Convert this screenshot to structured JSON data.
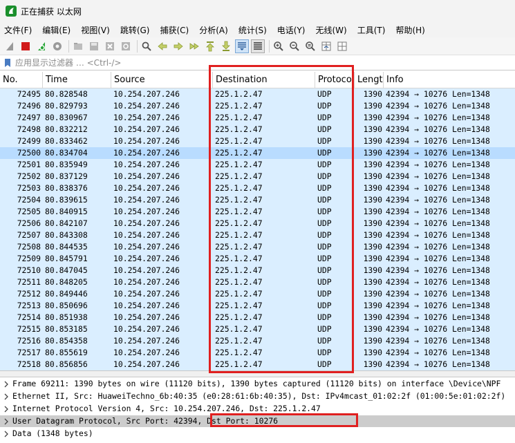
{
  "window": {
    "title": "正在捕获 以太网"
  },
  "menu": [
    "文件(F)",
    "编辑(E)",
    "视图(V)",
    "跳转(G)",
    "捕获(C)",
    "分析(A)",
    "统计(S)",
    "电话(Y)",
    "无线(W)",
    "工具(T)",
    "帮助(H)"
  ],
  "filter": {
    "placeholder": "应用显示过滤器 … <Ctrl-/>"
  },
  "columns": {
    "no": "No.",
    "time": "Time",
    "source": "Source",
    "destination": "Destination",
    "protocol": "Protoco",
    "length": "Lengt",
    "info": "Info"
  },
  "packets": [
    {
      "no": "72495",
      "time": "80.828548",
      "src": "10.254.207.246",
      "dst": "225.1.2.47",
      "proto": "UDP",
      "len": "1390",
      "info": "42394 → 10276 Len=1348"
    },
    {
      "no": "72496",
      "time": "80.829793",
      "src": "10.254.207.246",
      "dst": "225.1.2.47",
      "proto": "UDP",
      "len": "1390",
      "info": "42394 → 10276 Len=1348"
    },
    {
      "no": "72497",
      "time": "80.830967",
      "src": "10.254.207.246",
      "dst": "225.1.2.47",
      "proto": "UDP",
      "len": "1390",
      "info": "42394 → 10276 Len=1348"
    },
    {
      "no": "72498",
      "time": "80.832212",
      "src": "10.254.207.246",
      "dst": "225.1.2.47",
      "proto": "UDP",
      "len": "1390",
      "info": "42394 → 10276 Len=1348"
    },
    {
      "no": "72499",
      "time": "80.833462",
      "src": "10.254.207.246",
      "dst": "225.1.2.47",
      "proto": "UDP",
      "len": "1390",
      "info": "42394 → 10276 Len=1348"
    },
    {
      "no": "72500",
      "time": "80.834704",
      "src": "10.254.207.246",
      "dst": "225.1.2.47",
      "proto": "UDP",
      "len": "1390",
      "info": "42394 → 10276 Len=1348",
      "selected": true
    },
    {
      "no": "72501",
      "time": "80.835949",
      "src": "10.254.207.246",
      "dst": "225.1.2.47",
      "proto": "UDP",
      "len": "1390",
      "info": "42394 → 10276 Len=1348"
    },
    {
      "no": "72502",
      "time": "80.837129",
      "src": "10.254.207.246",
      "dst": "225.1.2.47",
      "proto": "UDP",
      "len": "1390",
      "info": "42394 → 10276 Len=1348"
    },
    {
      "no": "72503",
      "time": "80.838376",
      "src": "10.254.207.246",
      "dst": "225.1.2.47",
      "proto": "UDP",
      "len": "1390",
      "info": "42394 → 10276 Len=1348"
    },
    {
      "no": "72504",
      "time": "80.839615",
      "src": "10.254.207.246",
      "dst": "225.1.2.47",
      "proto": "UDP",
      "len": "1390",
      "info": "42394 → 10276 Len=1348"
    },
    {
      "no": "72505",
      "time": "80.840915",
      "src": "10.254.207.246",
      "dst": "225.1.2.47",
      "proto": "UDP",
      "len": "1390",
      "info": "42394 → 10276 Len=1348"
    },
    {
      "no": "72506",
      "time": "80.842107",
      "src": "10.254.207.246",
      "dst": "225.1.2.47",
      "proto": "UDP",
      "len": "1390",
      "info": "42394 → 10276 Len=1348"
    },
    {
      "no": "72507",
      "time": "80.843308",
      "src": "10.254.207.246",
      "dst": "225.1.2.47",
      "proto": "UDP",
      "len": "1390",
      "info": "42394 → 10276 Len=1348"
    },
    {
      "no": "72508",
      "time": "80.844535",
      "src": "10.254.207.246",
      "dst": "225.1.2.47",
      "proto": "UDP",
      "len": "1390",
      "info": "42394 → 10276 Len=1348"
    },
    {
      "no": "72509",
      "time": "80.845791",
      "src": "10.254.207.246",
      "dst": "225.1.2.47",
      "proto": "UDP",
      "len": "1390",
      "info": "42394 → 10276 Len=1348"
    },
    {
      "no": "72510",
      "time": "80.847045",
      "src": "10.254.207.246",
      "dst": "225.1.2.47",
      "proto": "UDP",
      "len": "1390",
      "info": "42394 → 10276 Len=1348"
    },
    {
      "no": "72511",
      "time": "80.848205",
      "src": "10.254.207.246",
      "dst": "225.1.2.47",
      "proto": "UDP",
      "len": "1390",
      "info": "42394 → 10276 Len=1348"
    },
    {
      "no": "72512",
      "time": "80.849446",
      "src": "10.254.207.246",
      "dst": "225.1.2.47",
      "proto": "UDP",
      "len": "1390",
      "info": "42394 → 10276 Len=1348"
    },
    {
      "no": "72513",
      "time": "80.850696",
      "src": "10.254.207.246",
      "dst": "225.1.2.47",
      "proto": "UDP",
      "len": "1390",
      "info": "42394 → 10276 Len=1348"
    },
    {
      "no": "72514",
      "time": "80.851938",
      "src": "10.254.207.246",
      "dst": "225.1.2.47",
      "proto": "UDP",
      "len": "1390",
      "info": "42394 → 10276 Len=1348"
    },
    {
      "no": "72515",
      "time": "80.853185",
      "src": "10.254.207.246",
      "dst": "225.1.2.47",
      "proto": "UDP",
      "len": "1390",
      "info": "42394 → 10276 Len=1348"
    },
    {
      "no": "72516",
      "time": "80.854358",
      "src": "10.254.207.246",
      "dst": "225.1.2.47",
      "proto": "UDP",
      "len": "1390",
      "info": "42394 → 10276 Len=1348"
    },
    {
      "no": "72517",
      "time": "80.855619",
      "src": "10.254.207.246",
      "dst": "225.1.2.47",
      "proto": "UDP",
      "len": "1390",
      "info": "42394 → 10276 Len=1348"
    },
    {
      "no": "72518",
      "time": "80.856856",
      "src": "10.254.207.246",
      "dst": "225.1.2.47",
      "proto": "UDP",
      "len": "1390",
      "info": "42394 → 10276 Len=1348"
    }
  ],
  "details": [
    {
      "text": "Frame 69211: 1390 bytes on wire (11120 bits), 1390 bytes captured (11120 bits) on interface \\Device\\NPF"
    },
    {
      "text": "Ethernet II, Src: HuaweiTechno_6b:40:35 (e0:28:61:6b:40:35), Dst: IPv4mcast_01:02:2f (01:00:5e:01:02:2f)"
    },
    {
      "text": "Internet Protocol Version 4, Src: 10.254.207.246, Dst: 225.1.2.47"
    },
    {
      "text_a": "User Datagram Protocol, Src Port: 42394, ",
      "text_b": "Dst Port: 10276",
      "highlight": true
    },
    {
      "text": "Data (1348 bytes)"
    }
  ],
  "colors": {
    "row_bg": "#daeeff",
    "row_selected_bg": "#b9dcff",
    "annotation": "#e02020"
  }
}
